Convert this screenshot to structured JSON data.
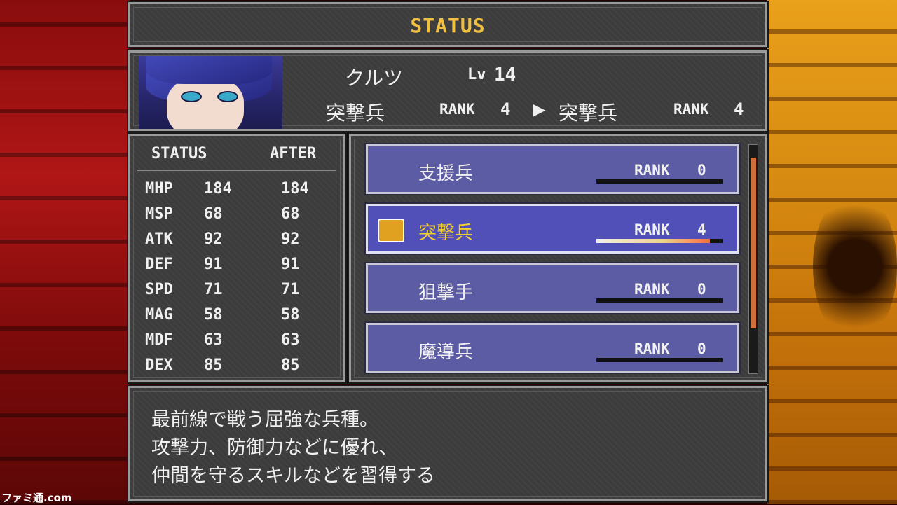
{
  "window_title": "STATUS",
  "character": {
    "name": "クルツ",
    "level_label": "Lv",
    "level": "14",
    "current_class": "突撃兵",
    "current_rank_label": "RANK",
    "current_rank": "4",
    "arrow": "▶",
    "new_class": "突撃兵",
    "new_rank_label": "RANK",
    "new_rank": "4"
  },
  "stats": {
    "header_status": "STATUS",
    "header_after": "AFTER",
    "rows": [
      {
        "name": "MHP",
        "value": "184",
        "after": "184"
      },
      {
        "name": "MSP",
        "value": "68",
        "after": "68"
      },
      {
        "name": "ATK",
        "value": "92",
        "after": "92"
      },
      {
        "name": "DEF",
        "value": "91",
        "after": "91"
      },
      {
        "name": "SPD",
        "value": "71",
        "after": "71"
      },
      {
        "name": "MAG",
        "value": "58",
        "after": "58"
      },
      {
        "name": "MDF",
        "value": "63",
        "after": "63"
      },
      {
        "name": "DEX",
        "value": "85",
        "after": "85"
      }
    ]
  },
  "classes": [
    {
      "name": "支援兵",
      "rank_label": "RANK",
      "rank": "0",
      "selected": false,
      "progress": 0.0
    },
    {
      "name": "突撃兵",
      "rank_label": "RANK",
      "rank": "4",
      "selected": true,
      "progress": 0.9
    },
    {
      "name": "狙撃手",
      "rank_label": "RANK",
      "rank": "0",
      "selected": false,
      "progress": 0.0
    },
    {
      "name": "魔導兵",
      "rank_label": "RANK",
      "rank": "0",
      "selected": false,
      "progress": 0.0
    }
  ],
  "description": {
    "line1": "最前線で戦う屈強な兵種。",
    "line2": "攻撃力、防御力などに優れ、",
    "line3": "仲間を守るスキルなどを習得する"
  },
  "watermark": "ファミ通.com",
  "colors": {
    "title": "#f0c040",
    "selected_name": "#f2d030",
    "panel": "#3c3c3c",
    "class_bg": "#5c5ca4"
  }
}
